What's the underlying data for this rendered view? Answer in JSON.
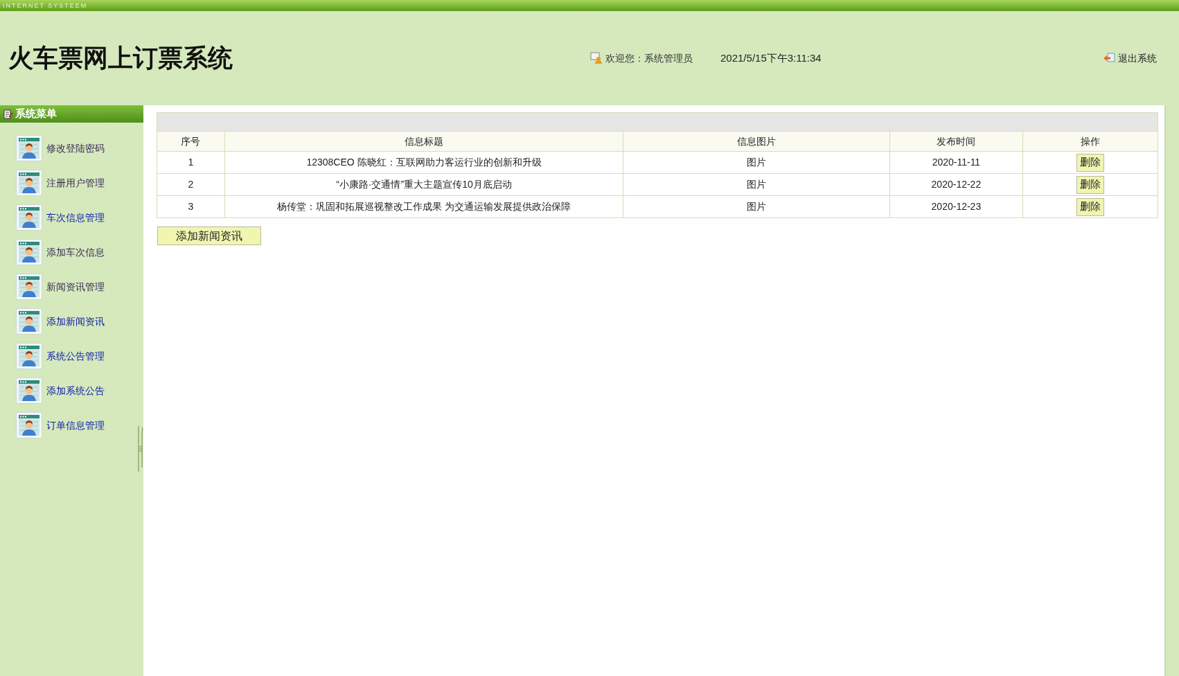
{
  "top_bar": {
    "label": "INTERNET SYSTEEM"
  },
  "header": {
    "title": "火车票网上订票系统",
    "welcome": "欢迎您：系统管理员",
    "datetime": "2021/5/15下午3:11:34",
    "logout": "退出系统"
  },
  "sidebar": {
    "title": "系统菜单",
    "items": [
      {
        "label": "修改登陆密码",
        "visited": true
      },
      {
        "label": "注册用户管理",
        "visited": true
      },
      {
        "label": "车次信息管理",
        "visited": false
      },
      {
        "label": "添加车次信息",
        "visited": true
      },
      {
        "label": "新闻资讯管理",
        "visited": true
      },
      {
        "label": "添加新闻资讯",
        "visited": false
      },
      {
        "label": "系统公告管理",
        "visited": false
      },
      {
        "label": "添加系统公告",
        "visited": false
      },
      {
        "label": "订单信息管理",
        "visited": false
      }
    ]
  },
  "table": {
    "columns": [
      "序号",
      "信息标题",
      "信息图片",
      "发布时间",
      "操作"
    ],
    "rows": [
      {
        "index": "1",
        "title": "12308CEO 陈晓红：互联网助力客运行业的创新和升级",
        "image": "图片",
        "date": "2020-11-11",
        "action": "删除"
      },
      {
        "index": "2",
        "title": "“小康路·交通情”重大主题宣传10月底启动",
        "image": "图片",
        "date": "2020-12-22",
        "action": "删除"
      },
      {
        "index": "3",
        "title": "杨传堂：巩固和拓展巡视整改工作成果 为交通运输发展提供政治保障",
        "image": "图片",
        "date": "2020-12-23",
        "action": "删除"
      }
    ]
  },
  "add_button": "添加新闻资讯"
}
